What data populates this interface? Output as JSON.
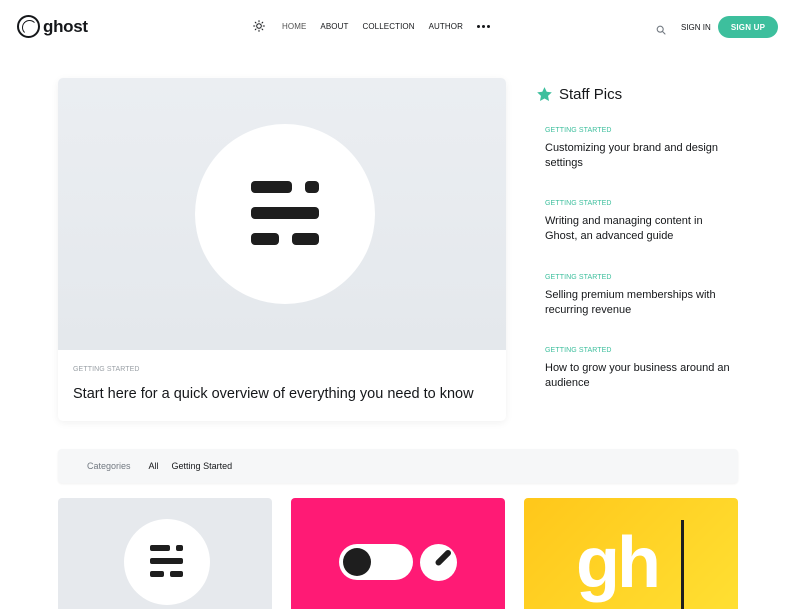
{
  "header": {
    "logo_text": "ghost",
    "nav": [
      {
        "label": "HOME"
      },
      {
        "label": "ABOUT"
      },
      {
        "label": "COLLECTION"
      },
      {
        "label": "AUTHOR"
      }
    ],
    "sign_in": "SIGN IN",
    "sign_up": "SIGN UP",
    "icons": [
      "sun-icon",
      "more-icon",
      "search-icon"
    ]
  },
  "featured": {
    "tag": "GETTING STARTED",
    "title": "Start here for a quick overview of everything you need to know"
  },
  "staff_picks": {
    "title": "Staff Pics",
    "items": [
      {
        "tag": "GETTING STARTED",
        "title": "Customizing your brand and design settings"
      },
      {
        "tag": "GETTING STARTED",
        "title": "Writing and managing content in Ghost, an advanced guide"
      },
      {
        "tag": "GETTING STARTED",
        "title": "Selling premium memberships with recurring revenue"
      },
      {
        "tag": "GETTING STARTED",
        "title": "How to grow your business around an audience"
      }
    ]
  },
  "categories": {
    "label": "Categories",
    "items": [
      "All",
      "Getting Started"
    ]
  },
  "cards": {
    "card3_text": "gh"
  },
  "colors": {
    "accent": "#3dbf9d",
    "card_pink": "#ff1a75",
    "card_yellow": "#ffd21f"
  }
}
